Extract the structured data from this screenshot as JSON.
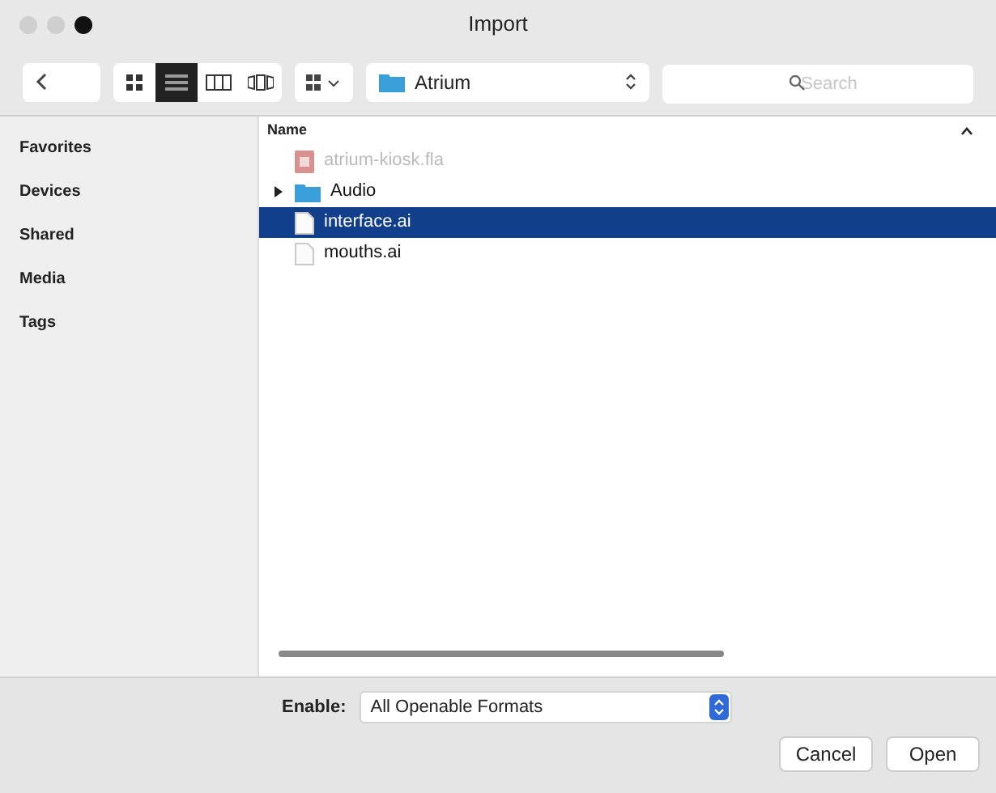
{
  "window": {
    "title": "Import"
  },
  "toolbar": {
    "location": "Atrium",
    "search": {
      "placeholder": "Search"
    },
    "view_modes": [
      {
        "kind": "icons",
        "selected": false
      },
      {
        "kind": "list",
        "selected": true
      },
      {
        "kind": "columns",
        "selected": false
      },
      {
        "kind": "coverflow",
        "selected": false
      }
    ]
  },
  "sidebar": {
    "sections": [
      "Favorites",
      "Devices",
      "Shared",
      "Media",
      "Tags"
    ]
  },
  "file_list": {
    "column": "Name",
    "items": [
      {
        "name": "atrium-kiosk.fla",
        "kind": "flash",
        "disabled": true,
        "selected": false
      },
      {
        "name": "Audio",
        "kind": "folder",
        "disabled": false,
        "selected": false,
        "expanded": false
      },
      {
        "name": "interface.ai",
        "kind": "document",
        "disabled": false,
        "selected": true
      },
      {
        "name": "mouths.ai",
        "kind": "document",
        "disabled": false,
        "selected": false
      }
    ]
  },
  "footer": {
    "enable_label": "Enable:",
    "format": "All Openable Formats",
    "buttons": [
      "Cancel",
      "Open"
    ]
  }
}
